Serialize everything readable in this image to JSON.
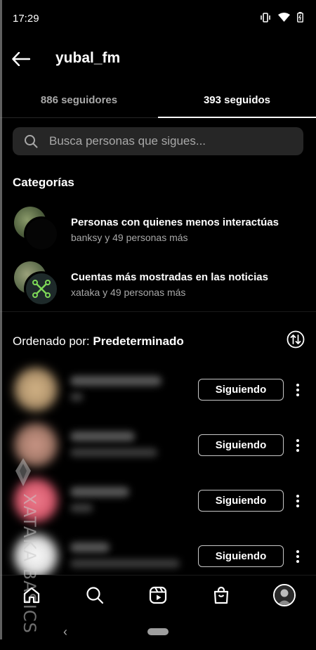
{
  "status_bar": {
    "time": "17:29"
  },
  "header": {
    "title": "yubal_fm"
  },
  "tabs": [
    {
      "label": "886 seguidores",
      "active": false
    },
    {
      "label": "393 seguidos",
      "active": true
    }
  ],
  "search": {
    "placeholder": "Busca personas que sigues..."
  },
  "categories_section": {
    "title": "Categorías",
    "items": [
      {
        "title": "Personas con quienes menos interactúas",
        "subtitle": "banksy y 49 personas más"
      },
      {
        "title": "Cuentas más mostradas en las noticias",
        "subtitle": "xataka y 49 personas más"
      }
    ]
  },
  "sort": {
    "label": "Ordenado por: ",
    "value": "Predeterminado"
  },
  "users": [
    {
      "button_label": "Siguiendo",
      "avatar_color": "#c9a77a"
    },
    {
      "button_label": "Siguiendo",
      "avatar_color": "#b88a7a"
    },
    {
      "button_label": "Siguiendo",
      "avatar_color": "#d9586c"
    },
    {
      "button_label": "Siguiendo",
      "avatar_color": "#f2f2f2"
    }
  ],
  "watermark": {
    "text": "XATAKA BASICS"
  },
  "colors": {
    "background": "#000000",
    "search_bg": "#262626",
    "secondary_text": "#a8a8a8",
    "xataka_green": "#7ed957"
  }
}
